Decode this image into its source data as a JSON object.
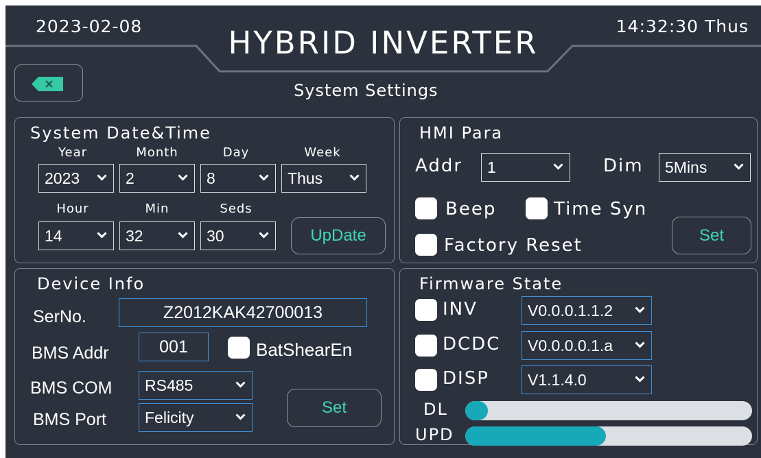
{
  "header": {
    "date": "2023-02-08",
    "title": "HYBRID INVERTER",
    "clock": "14:32:30 Thus"
  },
  "page_title": "System Settings",
  "back_button": {
    "icon": "backspace-icon",
    "color": "#35c9a6"
  },
  "date_time": {
    "title": "System Date&Time",
    "labels": {
      "year": "Year",
      "month": "Month",
      "day": "Day",
      "week": "Week",
      "hour": "Hour",
      "min": "Min",
      "seds": "Seds"
    },
    "values": {
      "year": "2023",
      "month": "2",
      "day": "8",
      "week": "Thus",
      "hour": "14",
      "min": "32",
      "seds": "30"
    },
    "update_label": "UpDate"
  },
  "hmi": {
    "title": "HMI Para",
    "addr_label": "Addr",
    "addr_value": "1",
    "dim_label": "Dim",
    "dim_value": "5Mins",
    "beep_label": "Beep",
    "beep_checked": false,
    "timesyn_label": "Time Syn",
    "timesyn_checked": false,
    "factory_label": "Factory Reset",
    "factory_checked": false,
    "set_label": "Set"
  },
  "device": {
    "title": "Device Info",
    "serno_label": "SerNo.",
    "serno_value": "Z2012KAK42700013",
    "bms_addr_label": "BMS Addr",
    "bms_addr_value": "001",
    "batshear_label": "BatShearEn",
    "batshear_checked": false,
    "bms_com_label": "BMS COM",
    "bms_com_value": "RS485",
    "bms_port_label": "BMS Port",
    "bms_port_value": "Felicity",
    "set_label": "Set"
  },
  "firmware": {
    "title": "Firmware State",
    "items": [
      {
        "label": "INV",
        "version": "V0.0.0.1.1.2",
        "checked": false
      },
      {
        "label": "DCDC",
        "version": "V0.0.0.0.1.a",
        "checked": false
      },
      {
        "label": "DISP",
        "version": "V1.1.4.0",
        "checked": false
      }
    ],
    "dl_label": "DL",
    "dl_progress": 0.08,
    "upd_label": "UPD",
    "upd_progress": 0.49
  },
  "colors": {
    "background": "#2c323d",
    "accent": "#3fd5b5",
    "field_border": "#3f8fd6",
    "progress_fill": "#17a9b8",
    "progress_track": "#dcdfe3"
  }
}
